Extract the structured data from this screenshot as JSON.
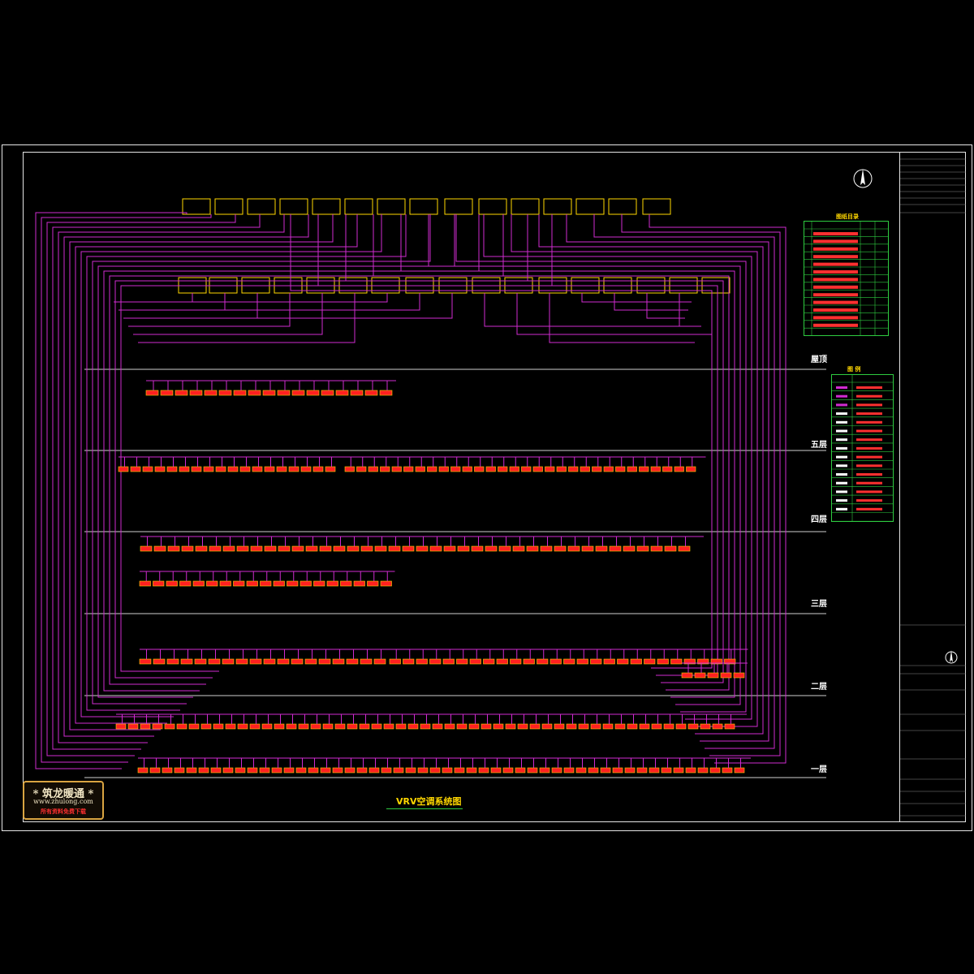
{
  "drawing": {
    "title": "VRV空调系统图",
    "floors": [
      "屋顶",
      "五层",
      "四层",
      "三层",
      "二层",
      "一层"
    ],
    "schedule_title": "图纸目录",
    "legend_title": "图 例"
  },
  "watermark": {
    "line1": "* 筑龙暖通 *",
    "line2": "www.zhulong.com",
    "line3": "所有资料免费下载"
  },
  "colors": {
    "pipe": "#d02bd0",
    "unit_fill": "#ff2020",
    "unit_border": "#ffd700",
    "label": "#ff3030",
    "frame": "#e6e6e6",
    "table_border": "#2ecc40"
  },
  "icons": [
    "north-arrow-icon",
    "compass-icon"
  ]
}
